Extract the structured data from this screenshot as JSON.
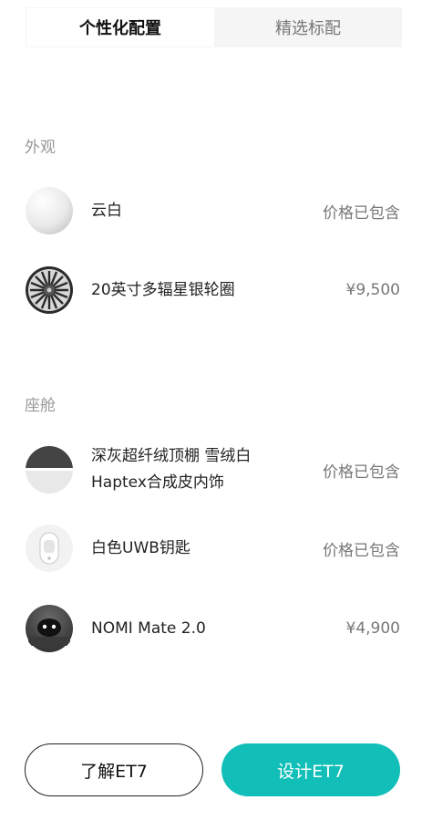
{
  "tabs": [
    {
      "label": "个性化配置",
      "active": true
    },
    {
      "label": "精选标配",
      "active": false
    }
  ],
  "sections": {
    "exterior": {
      "title": "外观",
      "items": [
        {
          "label_lines": [
            "云白"
          ],
          "price": "价格已包含",
          "icon": "cloud-white-paint-swatch"
        },
        {
          "label_lines": [
            "20英寸多辐星银轮圈"
          ],
          "price": "¥9,500",
          "icon": "multi-spoke-wheel"
        }
      ]
    },
    "cabin": {
      "title": "座舱",
      "items": [
        {
          "label_lines": [
            "深灰超纤绒顶棚 雪绒白",
            "Haptex合成皮内饰"
          ],
          "price": "价格已包含",
          "icon": "interior-trim-swatch"
        },
        {
          "label_lines": [
            "白色UWB钥匙"
          ],
          "price": "价格已包含",
          "icon": "uwb-key"
        },
        {
          "label_lines": [
            "NOMI Mate 2.0"
          ],
          "price": "¥4,900",
          "icon": "nomi-mate-robot"
        }
      ]
    }
  },
  "buttons": {
    "learn": "了解ET7",
    "design": "设计ET7"
  },
  "colors": {
    "accent": "#11bfb8",
    "muted": "#999999"
  }
}
